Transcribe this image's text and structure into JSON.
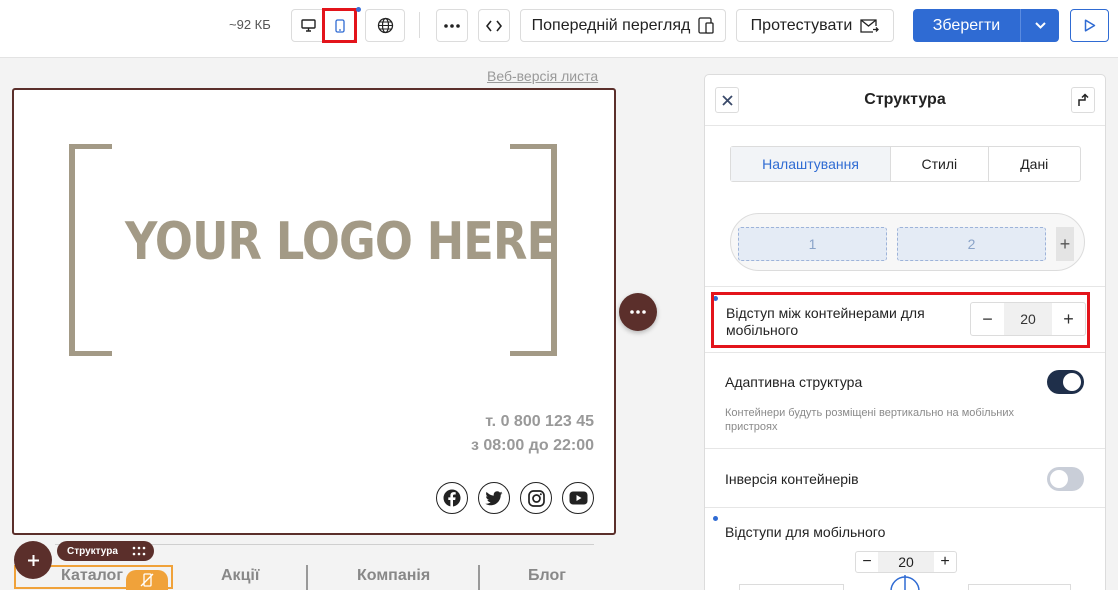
{
  "toolbar": {
    "size": "~92 КБ",
    "preview_label": "Попередній перегляд",
    "test_label": "Протестувати",
    "save_label": "Зберегти"
  },
  "canvas": {
    "web_version_link": "Веб-версія листа",
    "logo_text": "YOUR LOGO HERE",
    "phone": "т. 0 800 123 45",
    "hours": "з 08:00 до 22:00",
    "structure_tag": "Структура",
    "menu": [
      "Каталог",
      "Акції",
      "Компанія",
      "Блог"
    ]
  },
  "panel": {
    "title": "Структура",
    "tabs": [
      "Налаштування",
      "Стилі",
      "Дані"
    ],
    "containers": [
      "1",
      "2"
    ],
    "gap_label": "Відступ між контейнерами для мобільного",
    "gap_value": "20",
    "adaptive_label": "Адаптивна структура",
    "adaptive_hint": "Контейнери будуть розміщені вертикально на мобільних пристроях",
    "adaptive_on": true,
    "inversion_label": "Інверсія контейнерів",
    "inversion_on": false,
    "padding_label": "Відступи для мобільного",
    "padding_value": "20"
  },
  "colors": {
    "accent": "#2f6bd3",
    "brand": "#5b2f2b",
    "highlight": "#e3141b",
    "selection": "#f0a23a"
  }
}
